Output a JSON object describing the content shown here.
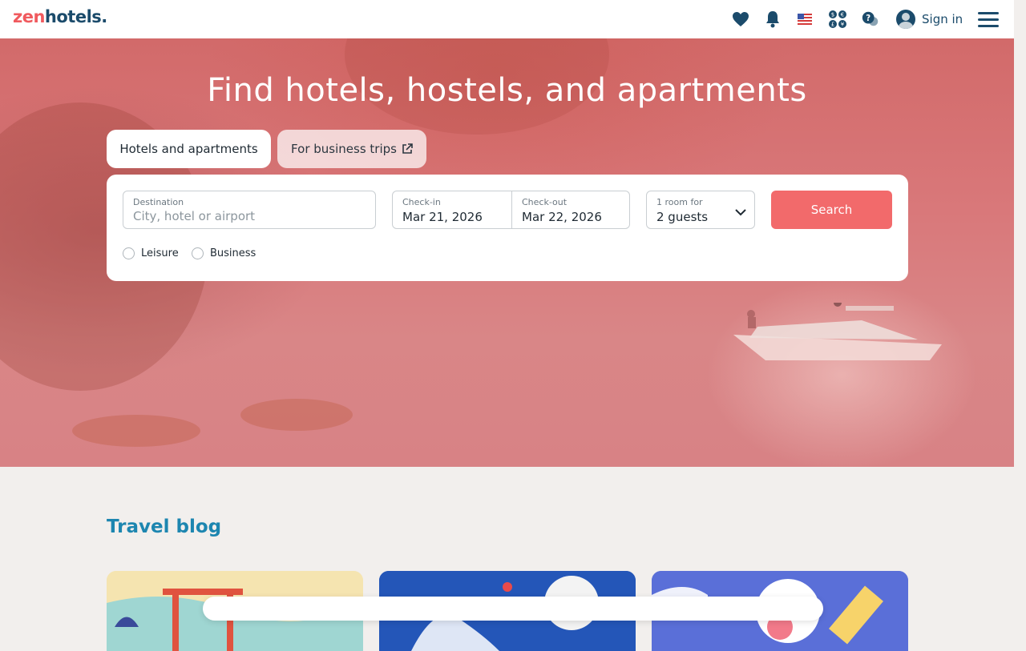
{
  "brand": {
    "logo_part1": "zen",
    "logo_part2": "hotels",
    "logo_dot": "."
  },
  "header": {
    "icons": [
      "favorites-heart-icon",
      "notifications-bell-icon",
      "us-flag-icon",
      "currency-icon",
      "help-chat-icon"
    ],
    "sign_in_label": "Sign in",
    "colors": {
      "primary": "#1b4b6b",
      "accent": "#f05a5e"
    }
  },
  "hero": {
    "title": "Find hotels, hostels, and apartments",
    "tabs": [
      {
        "label": "Hotels and apartments",
        "active": true
      },
      {
        "label": "For business trips",
        "active": false
      }
    ]
  },
  "search": {
    "destination": {
      "caption": "Destination",
      "placeholder": "City, hotel or airport",
      "value": ""
    },
    "check_in": {
      "caption": "Check-in",
      "value": "Mar 21, 2026"
    },
    "check_out": {
      "caption": "Check-out",
      "value": "Mar 22, 2026"
    },
    "guests": {
      "caption": "1 room for",
      "value": "2 guests"
    },
    "search_label": "Search",
    "trip_type": [
      {
        "label": "Leisure",
        "selected": false
      },
      {
        "label": "Business",
        "selected": false
      }
    ],
    "colors": {
      "button": "#f26a6b"
    }
  },
  "blog": {
    "title": "Travel blog",
    "cards": [
      "blog-card-japan",
      "blog-card-art",
      "blog-card-zenhotels"
    ]
  }
}
